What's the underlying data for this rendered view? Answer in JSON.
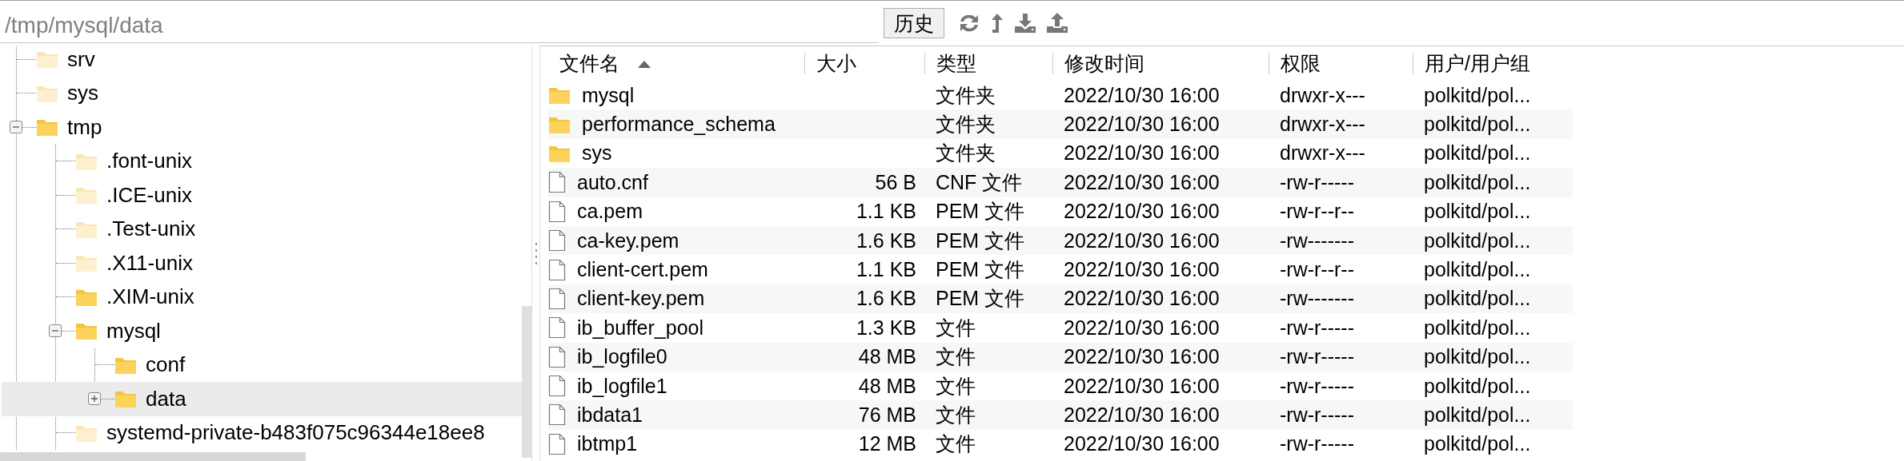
{
  "address_bar": {
    "value": "/tmp/mysql/data"
  },
  "toolbar": {
    "history_button": "历史"
  },
  "tree": {
    "items": [
      {
        "label": "srv",
        "dimmed": true,
        "selected": false
      },
      {
        "label": "sys",
        "dimmed": true,
        "selected": false
      },
      {
        "label": "tmp",
        "dimmed": false,
        "expanded": true,
        "selected": false,
        "children": [
          {
            "label": ".font-unix",
            "dimmed": true,
            "selected": false
          },
          {
            "label": ".ICE-unix",
            "dimmed": true,
            "selected": false
          },
          {
            "label": ".Test-unix",
            "dimmed": true,
            "selected": false
          },
          {
            "label": ".X11-unix",
            "dimmed": true,
            "selected": false
          },
          {
            "label": ".XIM-unix",
            "dimmed": false,
            "selected": false
          },
          {
            "label": "mysql",
            "dimmed": false,
            "expanded": true,
            "selected": false,
            "children": [
              {
                "label": "conf",
                "dimmed": false,
                "selected": false
              },
              {
                "label": "data",
                "dimmed": false,
                "expanded": false,
                "selected": true
              }
            ]
          },
          {
            "label": "systemd-private-b483f075c96344e18ee8",
            "dimmed": true,
            "selected": false
          }
        ]
      }
    ]
  },
  "file_list": {
    "columns": [
      {
        "label": "文件名",
        "sorted": true
      },
      {
        "label": "大小",
        "sorted": false
      },
      {
        "label": "类型",
        "sorted": false
      },
      {
        "label": "修改时间",
        "sorted": false
      },
      {
        "label": "权限",
        "sorted": false
      },
      {
        "label": "用户/用户组",
        "sorted": false
      }
    ],
    "rows": [
      {
        "kind": "folder",
        "name": "mysql",
        "type": "文件夹",
        "modified": "2022/10/30 16:00",
        "permissions": "drwxr-x---",
        "owner": "polkitd/pol..."
      },
      {
        "kind": "folder",
        "name": "performance_schema",
        "type": "文件夹",
        "modified": "2022/10/30 16:00",
        "permissions": "drwxr-x---",
        "owner": "polkitd/pol..."
      },
      {
        "kind": "folder",
        "name": "sys",
        "type": "文件夹",
        "modified": "2022/10/30 16:00",
        "permissions": "drwxr-x---",
        "owner": "polkitd/pol..."
      },
      {
        "kind": "file",
        "name": "auto.cnf",
        "size": "56 B",
        "type": "CNF 文件",
        "modified": "2022/10/30 16:00",
        "permissions": "-rw-r-----",
        "owner": "polkitd/pol..."
      },
      {
        "kind": "file",
        "name": "ca.pem",
        "size": "1.1 KB",
        "type": "PEM 文件",
        "modified": "2022/10/30 16:00",
        "permissions": "-rw-r--r--",
        "owner": "polkitd/pol..."
      },
      {
        "kind": "file",
        "name": "ca-key.pem",
        "size": "1.6 KB",
        "type": "PEM 文件",
        "modified": "2022/10/30 16:00",
        "permissions": "-rw-------",
        "owner": "polkitd/pol..."
      },
      {
        "kind": "file",
        "name": "client-cert.pem",
        "size": "1.1 KB",
        "type": "PEM 文件",
        "modified": "2022/10/30 16:00",
        "permissions": "-rw-r--r--",
        "owner": "polkitd/pol..."
      },
      {
        "kind": "file",
        "name": "client-key.pem",
        "size": "1.6 KB",
        "type": "PEM 文件",
        "modified": "2022/10/30 16:00",
        "permissions": "-rw-------",
        "owner": "polkitd/pol..."
      },
      {
        "kind": "file",
        "name": "ib_buffer_pool",
        "size": "1.3 KB",
        "type": "文件",
        "modified": "2022/10/30 16:00",
        "permissions": "-rw-r-----",
        "owner": "polkitd/pol..."
      },
      {
        "kind": "file",
        "name": "ib_logfile0",
        "size": "48 MB",
        "type": "文件",
        "modified": "2022/10/30 16:00",
        "permissions": "-rw-r-----",
        "owner": "polkitd/pol..."
      },
      {
        "kind": "file",
        "name": "ib_logfile1",
        "size": "48 MB",
        "type": "文件",
        "modified": "2022/10/30 16:00",
        "permissions": "-rw-r-----",
        "owner": "polkitd/pol..."
      },
      {
        "kind": "file",
        "name": "ibdata1",
        "size": "76 MB",
        "type": "文件",
        "modified": "2022/10/30 16:00",
        "permissions": "-rw-r-----",
        "owner": "polkitd/pol..."
      },
      {
        "kind": "file",
        "name": "ibtmp1",
        "size": "12 MB",
        "type": "文件",
        "modified": "2022/10/30 16:00",
        "permissions": "-rw-r-----",
        "owner": "polkitd/pol..."
      }
    ]
  }
}
